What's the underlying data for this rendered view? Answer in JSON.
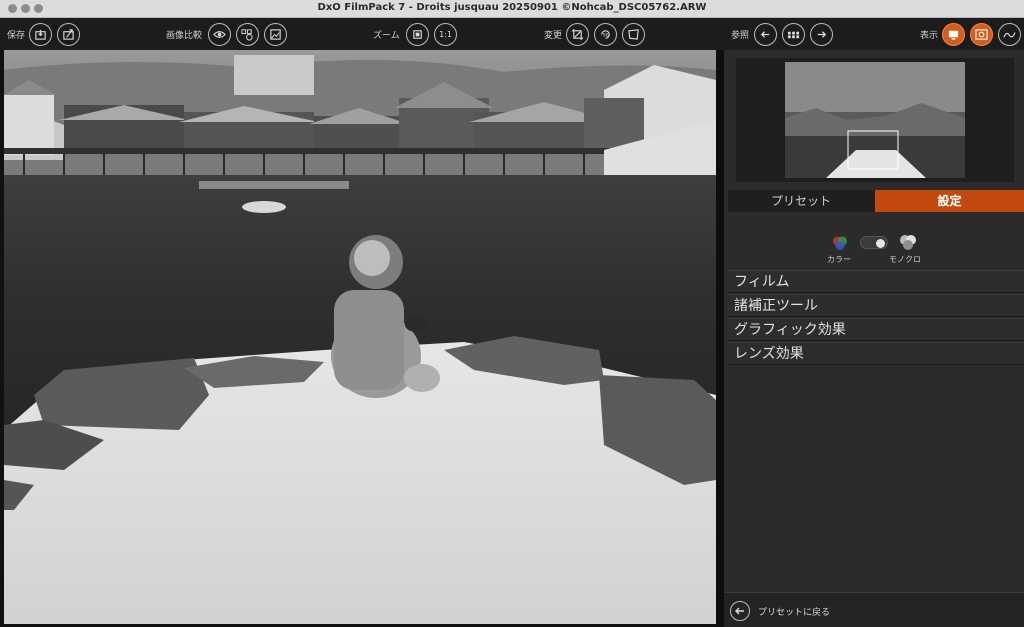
{
  "window": {
    "title": "DxO FilmPack 7 - Droits jusquau 20250901 ©Nohcab_DSC05762.ARW"
  },
  "toolbar": {
    "save_label": "保存",
    "compare_label": "画像比較",
    "zoom_label": "ズーム",
    "zoom_1to1": "1:1",
    "transform_label": "変更",
    "browse_label": "参照",
    "display_label": "表示"
  },
  "panel": {
    "tabs": [
      {
        "label": "プリセット"
      },
      {
        "label": "設定"
      }
    ],
    "active_tab": "設定",
    "mode": {
      "color_label": "カラー",
      "mono_label": "モノクロ",
      "selected": "モノクロ"
    },
    "sections": [
      {
        "label": "フィルム"
      },
      {
        "label": "諸補正ツール"
      },
      {
        "label": "グラフィック効果"
      },
      {
        "label": "レンズ効果"
      }
    ],
    "back_label": "プリセットに戻る"
  },
  "colors": {
    "accent": "#c24a10",
    "toolbar_bg": "#1c1c1c",
    "panel_bg": "#2b2b2b"
  },
  "icons": [
    "save-icon",
    "export-icon",
    "eye-icon",
    "split-compare-icon",
    "before-after-icon",
    "fit-icon",
    "crop-icon",
    "rotate-90-icon",
    "perspective-icon",
    "arrow-left-icon",
    "grid-icon",
    "arrow-right-icon",
    "display-screen-icon",
    "loupe-icon",
    "waveform-icon"
  ]
}
